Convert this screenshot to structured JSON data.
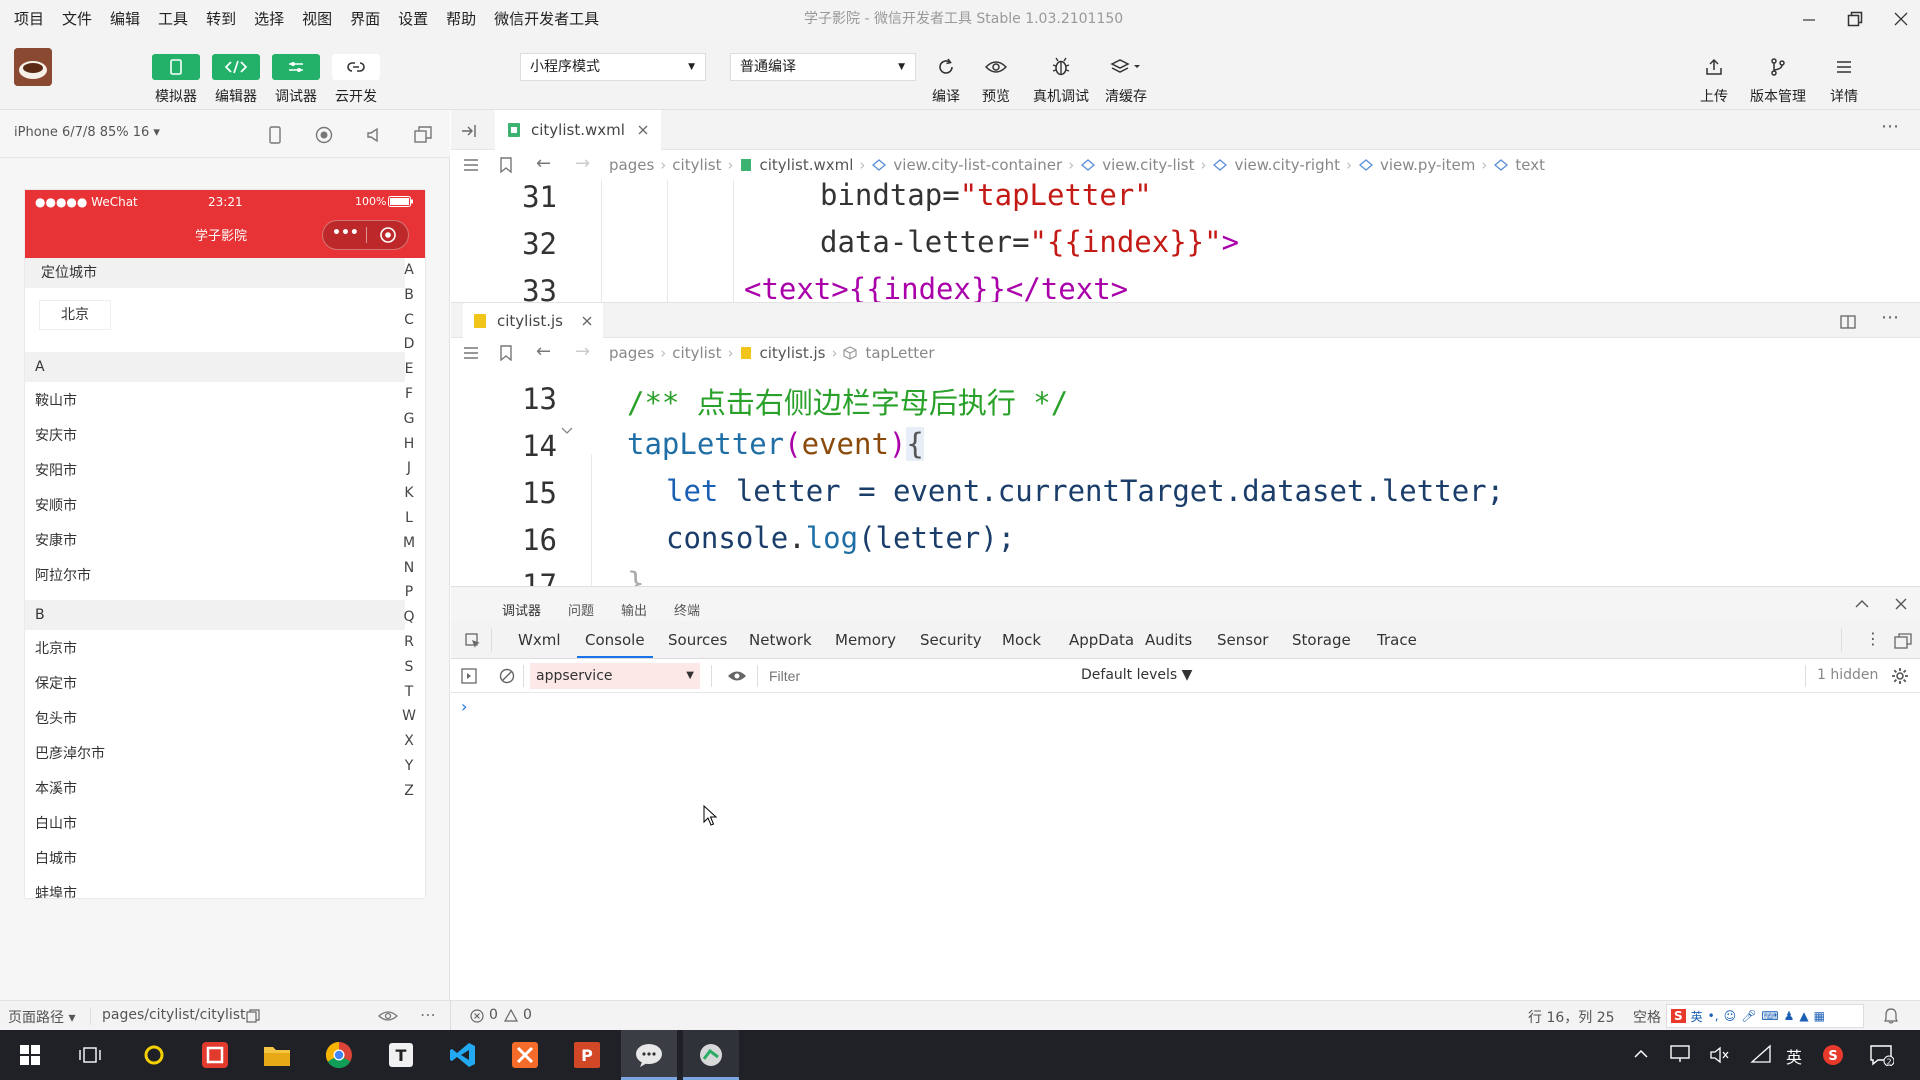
{
  "menu": [
    "项目",
    "文件",
    "编辑",
    "工具",
    "转到",
    "选择",
    "视图",
    "界面",
    "设置",
    "帮助",
    "微信开发者工具"
  ],
  "window_title": "学子影院 - 微信开发者工具 Stable 1.03.2101150",
  "toolbar": {
    "left_buttons": [
      "模拟器",
      "编辑器",
      "调试器",
      "云开发"
    ],
    "mode_select": "小程序模式",
    "compile_select": "普通编译",
    "mid_buttons": [
      "编译",
      "预览",
      "真机调试",
      "清缓存"
    ],
    "right_buttons": [
      "上传",
      "版本管理",
      "详情"
    ]
  },
  "simulator": {
    "device": "iPhone 6/7/8 85% 16 ▾",
    "status": {
      "carrier": "●●●●● WeChat",
      "time": "23:21",
      "battery": "100%"
    },
    "nav_title": "学子影院",
    "capsule_more": "•••",
    "locate_header": "定位城市",
    "locate_city": "北京",
    "sections": [
      {
        "letter": "A",
        "cities": [
          "鞍山市",
          "安庆市",
          "安阳市",
          "安顺市",
          "安康市",
          "阿拉尔市"
        ]
      },
      {
        "letter": "B",
        "cities": [
          "北京市",
          "保定市",
          "包头市",
          "巴彦淖尔市",
          "本溪市",
          "白山市",
          "白城市",
          "蚌埠市"
        ]
      }
    ],
    "index_letters": [
      "A",
      "B",
      "C",
      "D",
      "E",
      "F",
      "G",
      "H",
      "J",
      "K",
      "L",
      "M",
      "N",
      "P",
      "Q",
      "R",
      "S",
      "T",
      "W",
      "X",
      "Y",
      "Z"
    ]
  },
  "editor_top": {
    "tab": "citylist.wxml",
    "breadcrumb": [
      "pages",
      "citylist",
      "citylist.wxml",
      "view.city-list-container",
      "view.city-list",
      "view.city-right",
      "view.py-item",
      "text"
    ],
    "lines": [
      {
        "n": "31",
        "indent": "  ",
        "attr": "bindtap",
        "eq": "=",
        "val": "\"tapLetter\""
      },
      {
        "n": "32",
        "indent": "  ",
        "attr": "data-letter",
        "eq": "=",
        "val": "\"{{index}}\"",
        "tail": ">"
      },
      {
        "n": "33",
        "text": "<text>{{index}}</text>"
      }
    ]
  },
  "editor_bottom": {
    "tab": "citylist.js",
    "breadcrumb": [
      "pages",
      "citylist",
      "citylist.js",
      "tapLetter"
    ],
    "lines": [
      {
        "n": "13",
        "comment": "/** 点击右侧边栏字母后执行 */"
      },
      {
        "n": "14",
        "fn": "tapLetter",
        "open": "(",
        "param": "event",
        "close": ")",
        "brace": "{"
      },
      {
        "n": "15",
        "kw": "let",
        "rest": " letter = event.currentTarget.dataset.letter;"
      },
      {
        "n": "16",
        "obj": "console",
        "dot": ".",
        "method": "log",
        "args": "(letter);"
      },
      {
        "n": "17",
        "partial": "}"
      }
    ]
  },
  "devtools": {
    "top_tabs": [
      "调试器",
      "问题",
      "输出",
      "终端"
    ],
    "tabs": [
      "Wxml",
      "Console",
      "Sources",
      "Network",
      "Memory",
      "Security",
      "Mock",
      "AppData",
      "Audits",
      "Sensor",
      "Storage",
      "Trace"
    ],
    "active_tab": "Console",
    "context": "appservice",
    "filter_placeholder": "Filter",
    "levels": "Default levels ▼",
    "hidden": "1 hidden",
    "prompt": "›"
  },
  "statusbar": {
    "page_path_label": "页面路径 ▾",
    "page_path": "pages/citylist/citylist",
    "errors": "0",
    "warnings": "0",
    "cursor": "行 16，列 25",
    "space": "空格"
  },
  "taskbar": {
    "ime": "英"
  }
}
